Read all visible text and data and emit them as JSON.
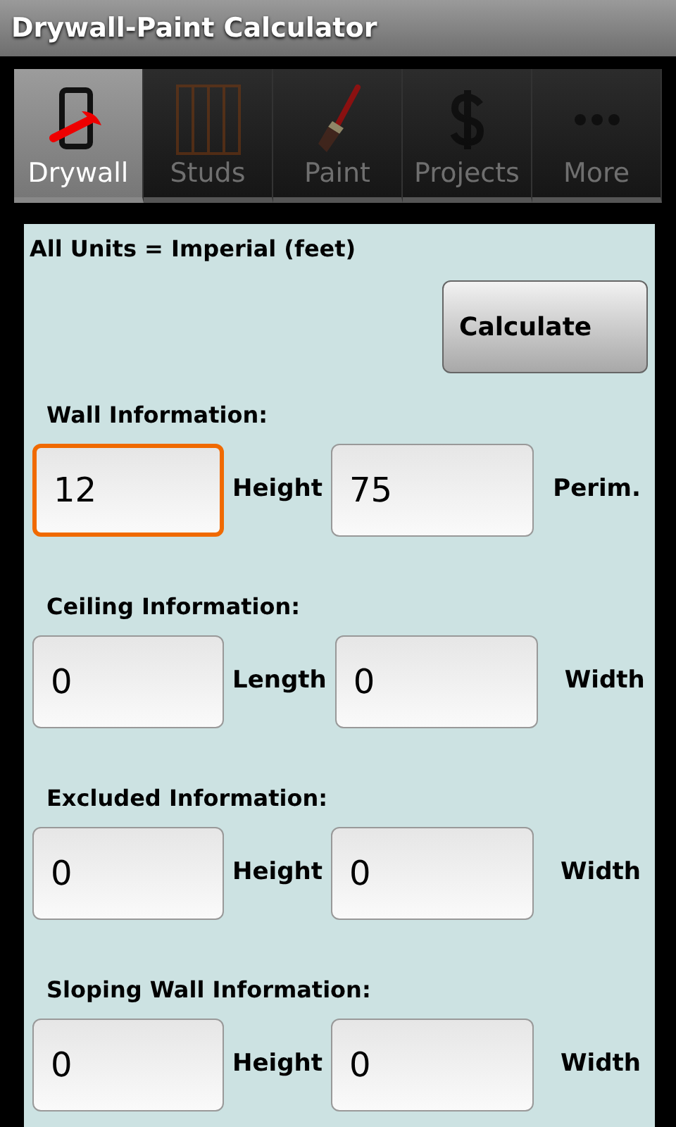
{
  "window": {
    "title": "Drywall-Paint Calculator"
  },
  "tabs": [
    {
      "label": "Drywall",
      "kind": "drywall",
      "selected": true
    },
    {
      "label": "Studs",
      "kind": "studs",
      "selected": false
    },
    {
      "label": "Paint",
      "kind": "paint",
      "selected": false
    },
    {
      "label": "Projects",
      "kind": "projects",
      "selected": false
    },
    {
      "label": "More",
      "kind": "more",
      "selected": false
    }
  ],
  "units_note": "All Units = Imperial (feet)",
  "calculate_button": "Calculate",
  "sections": [
    {
      "title": "Wall Information:",
      "row": [
        {
          "kind": "field",
          "value": "12",
          "focused": true
        },
        {
          "kind": "label",
          "text": "Height"
        },
        {
          "kind": "field",
          "value": "75",
          "focused": false
        },
        {
          "kind": "label",
          "text": "Perim."
        }
      ]
    },
    {
      "title": "Ceiling Information:",
      "row": [
        {
          "kind": "field",
          "value": "0",
          "focused": false
        },
        {
          "kind": "label",
          "text": "Length"
        },
        {
          "kind": "field",
          "value": "0",
          "focused": false
        },
        {
          "kind": "label",
          "text": "Width"
        }
      ]
    },
    {
      "title": "Excluded Information:",
      "row": [
        {
          "kind": "field",
          "value": "0",
          "focused": false
        },
        {
          "kind": "label",
          "text": "Height"
        },
        {
          "kind": "field",
          "value": "0",
          "focused": false
        },
        {
          "kind": "label",
          "text": "Width"
        }
      ]
    },
    {
      "title": "Sloping Wall Information:",
      "row": [
        {
          "kind": "field",
          "value": "0",
          "focused": false
        },
        {
          "kind": "label",
          "text": "Height"
        },
        {
          "kind": "field",
          "value": "0",
          "focused": false
        },
        {
          "kind": "label",
          "text": "Width"
        }
      ]
    }
  ]
}
